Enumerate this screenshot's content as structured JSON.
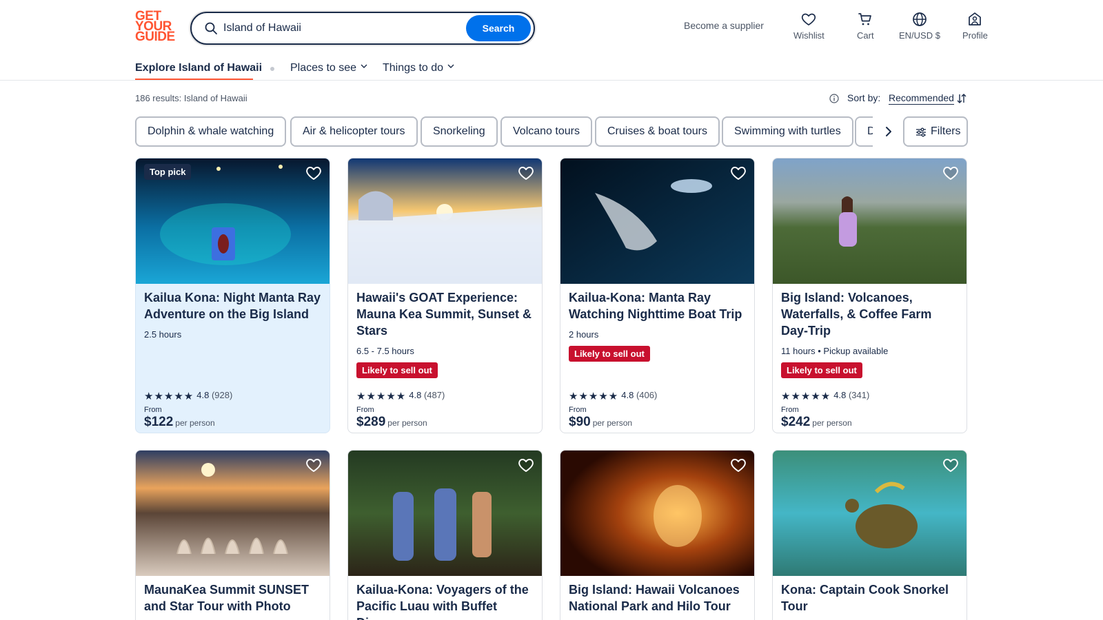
{
  "header": {
    "logo_lines": [
      "GET",
      "YOUR",
      "GUIDE"
    ],
    "search_value": "Island of Hawaii",
    "search_button": "Search",
    "supplier_link": "Become a supplier",
    "wishlist": "Wishlist",
    "cart": "Cart",
    "locale": "EN/USD $",
    "profile": "Profile"
  },
  "subnav": {
    "explore": "Explore Island of Hawaii",
    "places": "Places to see",
    "things": "Things to do"
  },
  "results": {
    "count_text": "186 results:",
    "location": "Island of Hawaii",
    "sort_label": "Sort by:",
    "sort_value": "Recommended"
  },
  "chips": [
    "Dolphin & whale watching",
    "Air & helicopter tours",
    "Snorkeling",
    "Volcano tours",
    "Cruises & boat tours",
    "Swimming with turtles",
    "Day trips"
  ],
  "filters_label": "Filters",
  "colors": {
    "brand": "#ff5533",
    "primary": "#0071eb",
    "sellout": "#c8102e",
    "text": "#1a2b49"
  },
  "cards": [
    {
      "title": "Kailua Kona: Night Manta Ray Adventure on the Big Island",
      "badge": "Top pick",
      "meta": "2.5 hours",
      "sellout": "",
      "rating": "4.8",
      "reviews": "(928)",
      "from": "From",
      "price": "$122",
      "unit": "per person",
      "highlight": true
    },
    {
      "title": "Hawaii's GOAT Experience: Mauna Kea Summit, Sunset & Stars",
      "badge": "",
      "meta": "6.5 - 7.5 hours",
      "sellout": "Likely to sell out",
      "rating": "4.8",
      "reviews": "(487)",
      "from": "From",
      "price": "$289",
      "unit": "per person",
      "highlight": false
    },
    {
      "title": "Kailua-Kona: Manta Ray Watching Nighttime Boat Trip",
      "badge": "",
      "meta": "2 hours",
      "sellout": "Likely to sell out",
      "rating": "4.8",
      "reviews": "(406)",
      "from": "From",
      "price": "$90",
      "unit": "per person",
      "highlight": false
    },
    {
      "title": "Big Island: Volcanoes, Waterfalls, & Coffee Farm Day-Trip",
      "badge": "",
      "meta": "11 hours • Pickup available",
      "sellout": "Likely to sell out",
      "rating": "4.8",
      "reviews": "(341)",
      "from": "From",
      "price": "$242",
      "unit": "per person",
      "highlight": false
    },
    {
      "title": "MaunaKea Summit SUNSET and Star Tour with Photo"
    },
    {
      "title": "Kailua-Kona: Voyagers of the Pacific Luau with Buffet Dinner"
    },
    {
      "title": "Big Island: Hawaii Volcanoes National Park and Hilo Tour"
    },
    {
      "title": "Kona: Captain Cook Snorkel Tour"
    }
  ]
}
